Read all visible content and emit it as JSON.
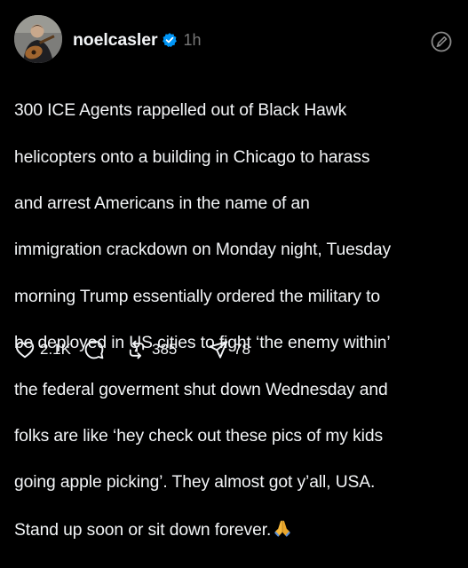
{
  "post": {
    "author": {
      "username": "noelcasler",
      "verified": true,
      "avatar_icon": "avatar-guitar-player"
    },
    "timestamp": "1h",
    "edit_icon": "edit-pencil-circle-icon",
    "body_lines": [
      "300 ICE Agents rappelled out of Black Hawk",
      "helicopters onto a building in Chicago to harass",
      "and arrest Americans in the name of an",
      "immigration crackdown on Monday night, Tuesday",
      "morning Trump essentially ordered the military to",
      "be deployed in US cities to fight ‘the enemy within’",
      "the federal goverment shut down Wednesday and",
      "folks are like ‘hey check out these pics of my kids",
      "going apple picking’. They almost got y’all, USA.",
      "Stand up soon or sit down forever."
    ],
    "emoji": "folded-hands-emoji",
    "actions": {
      "likes": "2.1K",
      "reposts": "385",
      "shares": "78"
    }
  },
  "colors": {
    "background": "#000000",
    "text": "#f3f5f7",
    "muted": "#777777",
    "verified_blue": "#0095f6"
  }
}
